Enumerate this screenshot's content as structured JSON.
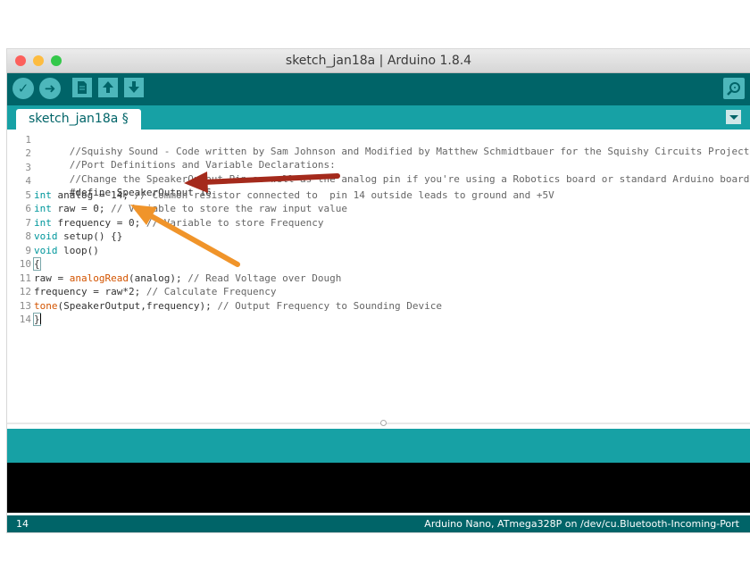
{
  "window": {
    "title": "sketch_jan18a | Arduino 1.8.4",
    "traffic_lights": {
      "close": "#fc605c",
      "minimize": "#fdbc40",
      "zoom": "#34c84a"
    }
  },
  "toolbar": {
    "verify_icon": "check-icon",
    "upload_icon": "arrow-right-icon",
    "new_icon": "new-sketch-icon",
    "open_icon": "arrow-up-icon",
    "save_icon": "arrow-down-icon",
    "serial_monitor_icon": "magnifier-icon"
  },
  "tabs": [
    {
      "label": "sketch_jan18a §"
    }
  ],
  "editor": {
    "lines": [
      {
        "n": "1",
        "text": "//Squishy Sound - Code written by Sam Johnson and Modified by Matthew Schmidtbauer for the Squishy Circuits Project"
      },
      {
        "n": "2",
        "text": "//Port Definitions and Variable Declarations:"
      },
      {
        "n": "3",
        "text": "//Change the SpeakerOutput Pin as well as the analog pin if you're using a Robotics board or standard Arduino board."
      },
      {
        "n": "4",
        "text": "#define SpeakerOutput 16"
      },
      {
        "n": "5",
        "kw": "int",
        "rest": " analog = 14; ",
        "comment": "// Common resistor connected to  pin 14 outside leads to ground and +5V"
      },
      {
        "n": "6",
        "kw": "int",
        "rest": " raw = 0; ",
        "comment": "// Variable to store the raw input value"
      },
      {
        "n": "7",
        "kw": "int",
        "rest": " frequency = 0; ",
        "comment": "// Variable to store Frequency"
      },
      {
        "n": "8",
        "kw": "void",
        "rest": " setup() {}"
      },
      {
        "n": "9",
        "kw": "void",
        "rest": " loop()"
      },
      {
        "n": "10",
        "text": "{"
      },
      {
        "n": "11",
        "pre": "raw = ",
        "fn": "analogRead",
        "post": "(analog); ",
        "comment": "// Read Voltage over Dough"
      },
      {
        "n": "12",
        "text": "frequency = raw*2; ",
        "comment": "// Calculate Frequency"
      },
      {
        "n": "13",
        "fn": "tone",
        "post": "(SpeakerOutput,frequency); ",
        "comment": "// Output Frequency to Sounding Device"
      },
      {
        "n": "14",
        "text": "}"
      }
    ]
  },
  "status": {
    "line_number": "14",
    "board": "Arduino Nano, ATmega328P on /dev/cu.Bluetooth-Incoming-Port"
  },
  "colors": {
    "toolbar": "#006468",
    "tab_bar": "#17a1a5",
    "keyword": "#00979c",
    "function": "#d35400",
    "arrow_red": "#a42a1c",
    "arrow_orange": "#f0942a"
  }
}
